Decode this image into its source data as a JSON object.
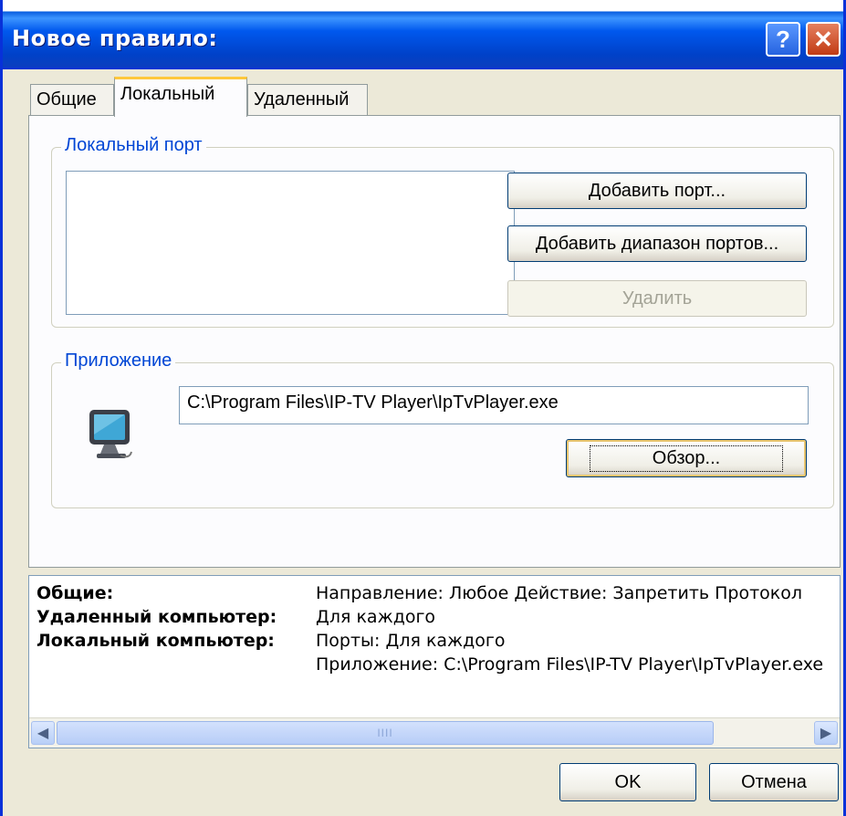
{
  "window": {
    "title": "Новое правило:",
    "help_glyph": "?",
    "close_glyph": "✕"
  },
  "tabs": [
    {
      "label": "Общие",
      "active": false
    },
    {
      "label": "Локальный",
      "active": true
    },
    {
      "label": "Удаленный",
      "active": false
    }
  ],
  "local_port": {
    "legend": "Локальный порт",
    "items": [],
    "add_port_label": "Добавить порт...",
    "add_range_label": "Добавить диапазон портов...",
    "delete_label": "Удалить"
  },
  "application": {
    "legend": "Приложение",
    "path": "C:\\Program Files\\IP-TV Player\\IpTvPlayer.exe",
    "browse_label": "Обзор...",
    "icon": "computer-monitor-icon"
  },
  "summary": {
    "rows": [
      {
        "label": "Общие:",
        "value": "Направление: Любое   Действие: Запретить   Протокол"
      },
      {
        "label": "Удаленный компьютер:",
        "value": "Для каждого"
      },
      {
        "label": "Локальный компьютер:",
        "value": "Порты: Для каждого"
      },
      {
        "label": "",
        "value": "Приложение: C:\\Program Files\\IP-TV Player\\IpTvPlayer.exe"
      }
    ],
    "scroll_grip": "IIII"
  },
  "footer": {
    "ok_label": "OK",
    "cancel_label": "Отмена"
  },
  "colors": {
    "titlebar": "#0058ee",
    "legend": "#0046d5",
    "face": "#ece9d8"
  }
}
